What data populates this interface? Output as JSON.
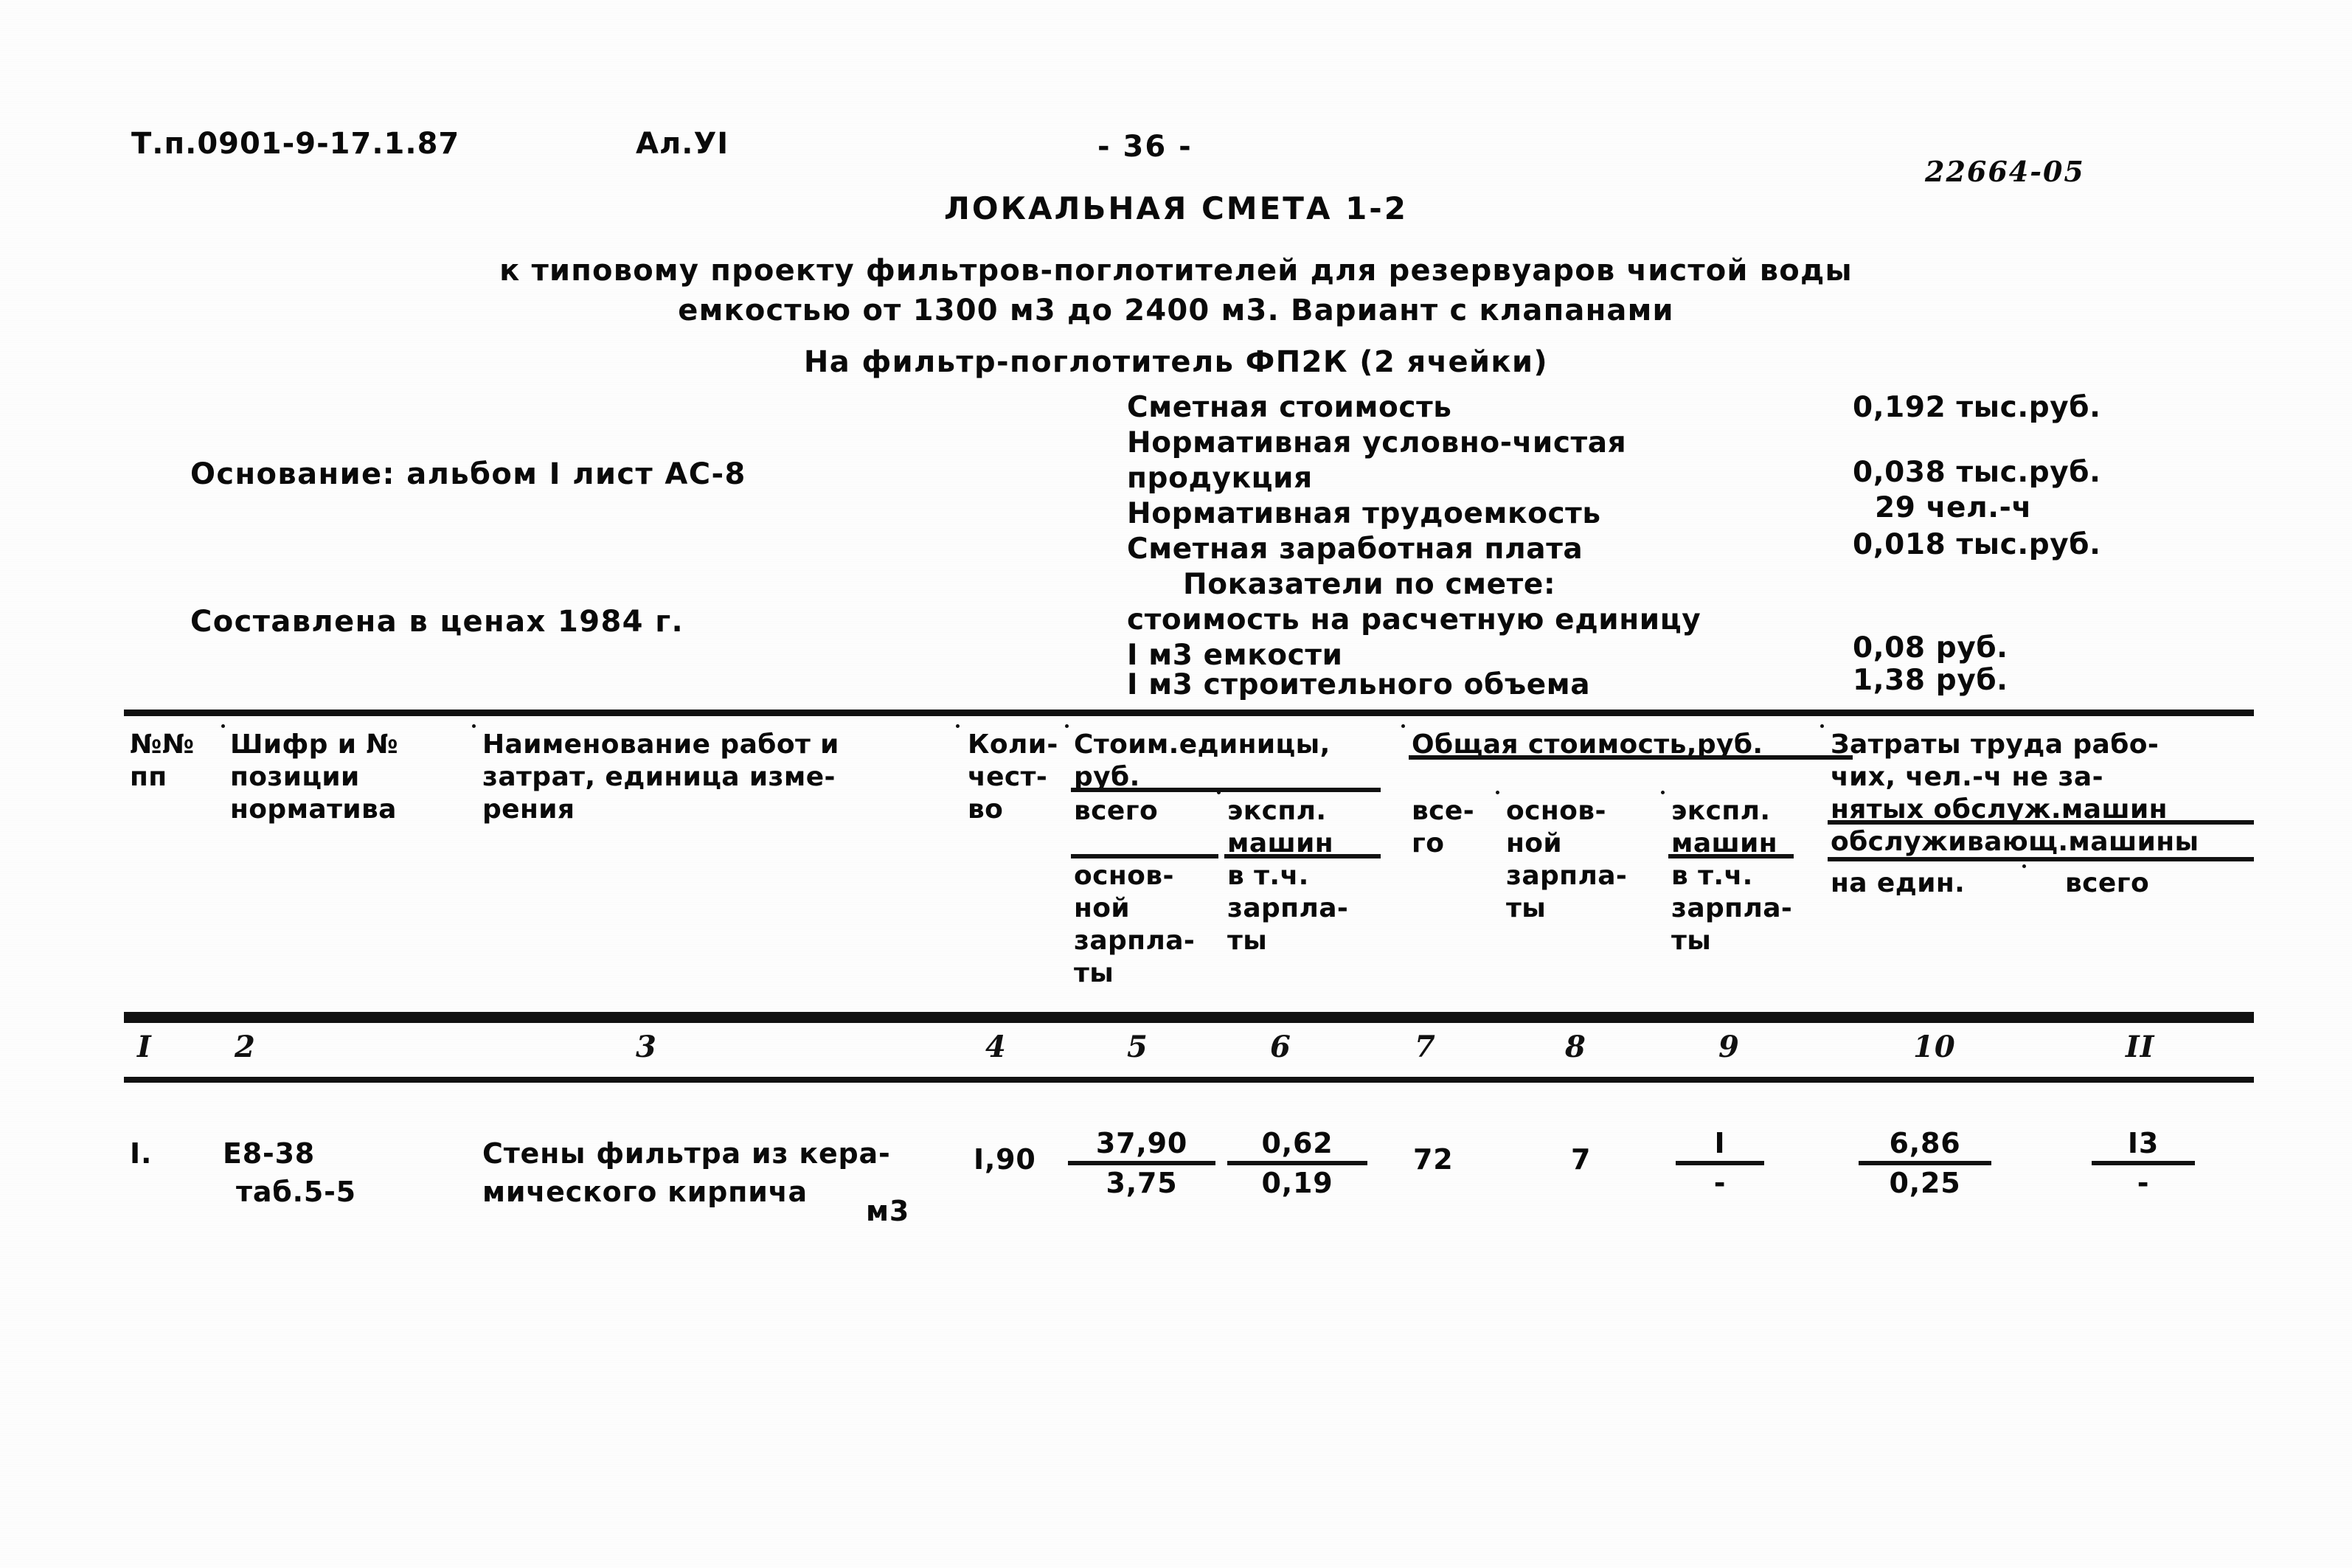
{
  "header": {
    "doc_code": "Т.п.0901-9-17.1.87",
    "album_label": "Ал.УІ",
    "page_number": "- 36 -",
    "archive_code": "22664-05"
  },
  "titles": {
    "main": "ЛОКАЛЬНАЯ СМЕТА 1-2",
    "sub1": "к типовому проекту фильтров-поглотителей для резервуаров чистой воды",
    "sub2": "емкостью от 1300 м3 до 2400 м3. Вариант с клапанами",
    "sub3": "На фильтр-поглотитель ФП2К (2 ячейки)"
  },
  "info": {
    "basis": "Основание: альбом I лист АС-8",
    "prices": "Составлена в ценах 1984 г."
  },
  "summary": {
    "rows": [
      {
        "label": "Сметная стоимость",
        "value": "0,192 тыс.руб."
      },
      {
        "label": "Нормативная условно-чистая",
        "value": ""
      },
      {
        "label": "продукция",
        "value": "0,038 тыс.руб."
      },
      {
        "label": "Нормативная трудоемкость",
        "value": "29 чел.-ч"
      },
      {
        "label": "Сметная заработная плата",
        "value": "0,018 тыс.руб."
      },
      {
        "label": "Показатели по смете:",
        "value": ""
      },
      {
        "label": "стоимость на расчетную единицу",
        "value": ""
      },
      {
        "label": "I м3 емкости",
        "value": "0,08 руб."
      },
      {
        "label": "I м3 строительного объема",
        "value": "1,38 руб."
      }
    ]
  },
  "table": {
    "headers": {
      "col1": "№№\nпп",
      "col2": "Шифр и №\nпозиции\nнорматива",
      "col3": "Наименование работ и\nзатрат, единица изме-\nрения",
      "col4": "Коли-\nчест-\nво",
      "group5": "Стоим.единицы,\nруб.",
      "col5": "всего",
      "col5b": "основ-\nной\nзарпла-\nты",
      "col6": "экспл.\nмашин",
      "col6b": "в т.ч.\nзарпла-\nты",
      "group7": "Общая стоимость,руб.",
      "col7": "все-\nго",
      "col8": "основ-\nной\nзарпла-\nты",
      "col9": "экспл.\nмашин\nв т.ч.\nзарпла-\nты",
      "group10": "Затраты труда рабо-\nчих, чел.-ч не за-\nнятых обслуж.машин\nобслуживающ.машины",
      "col10": "на един.",
      "col11": "всего"
    },
    "column_numbers": [
      "I",
      "2",
      "3",
      "4",
      "5",
      "6",
      "7",
      "8",
      "9",
      "10",
      "II"
    ],
    "rows": [
      {
        "num": "I.",
        "norm_code_1": "Е8-38",
        "norm_code_2": "таб.5-5",
        "name_1": "Стены фильтра из кера-",
        "name_2": "мического кирпича",
        "unit": "м3",
        "qty": "I,90",
        "unit_cost_total": "37,90",
        "unit_cost_wage": "3,75",
        "unit_mach_total": "0,62",
        "unit_mach_wage": "0,19",
        "total_all": "72",
        "total_wage": "7",
        "total_mach_top": "I",
        "total_mach_bottom": "-",
        "labour_unit_top": "6,86",
        "labour_unit_bottom": "0,25",
        "labour_total_top": "I3",
        "labour_total_bottom": "-"
      }
    ]
  }
}
